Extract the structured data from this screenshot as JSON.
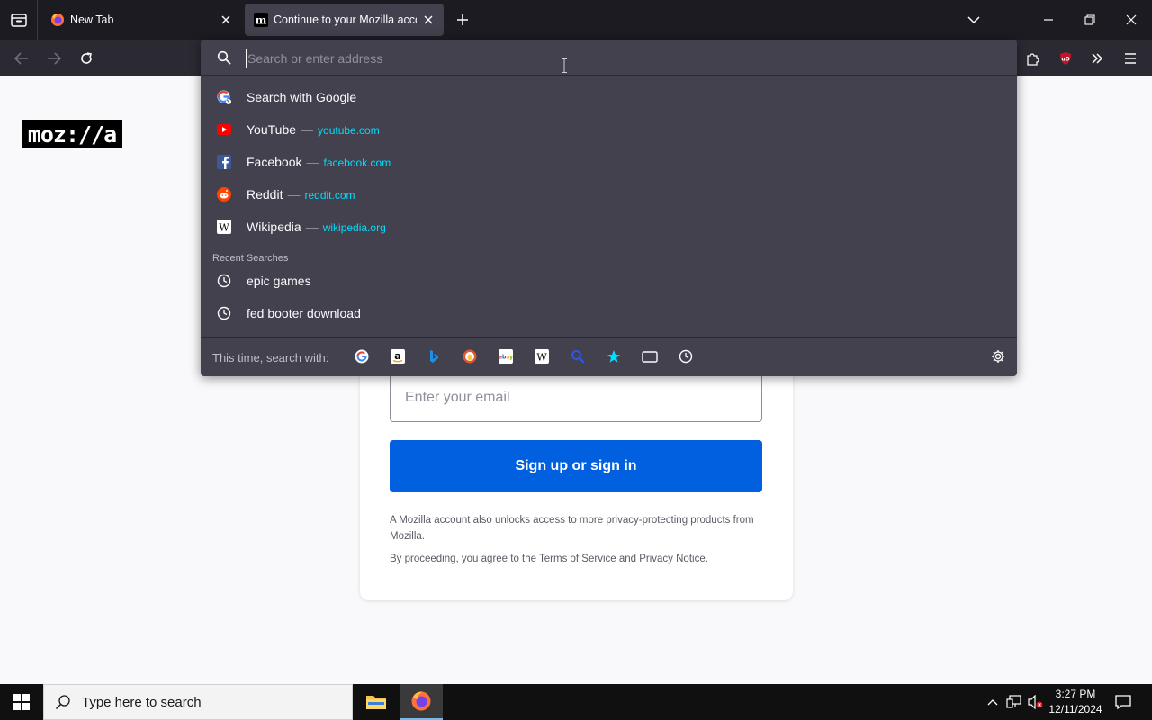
{
  "browser": {
    "tabs": [
      {
        "title": "New Tab",
        "favicon": "firefox-icon",
        "active": false
      },
      {
        "title": "Continue to your Mozilla account",
        "favicon": "mozilla-m-icon",
        "active": true
      }
    ]
  },
  "urlbar": {
    "placeholder": "Search or enter address",
    "value": "",
    "suggestions": [
      {
        "label": "Search with Google",
        "url": "",
        "icon": "google-icon"
      },
      {
        "label": "YouTube",
        "url": "youtube.com",
        "icon": "youtube-icon"
      },
      {
        "label": "Facebook",
        "url": "facebook.com",
        "icon": "facebook-icon"
      },
      {
        "label": "Reddit",
        "url": "reddit.com",
        "icon": "reddit-icon"
      },
      {
        "label": "Wikipedia",
        "url": "wikipedia.org",
        "icon": "wikipedia-icon"
      }
    ],
    "separator": "—",
    "recent_label": "Recent Searches",
    "recent": [
      "epic games",
      "fed booter download"
    ],
    "oneoff_label": "This time, search with:",
    "engines": [
      "google",
      "amazon",
      "bing",
      "duckduckgo",
      "ebay",
      "wikipedia",
      "search",
      "bookmarks",
      "tabs",
      "history"
    ]
  },
  "page": {
    "logo": "moz://a",
    "email_placeholder": "Enter your email",
    "signin_label": "Sign up or sign in",
    "legal_text": "A Mozilla account also unlocks access to more privacy-protecting products from Mozilla.",
    "terms_prefix": "By proceeding, you agree to the ",
    "terms_link": "Terms of Service",
    "terms_and": " and ",
    "privacy_link": "Privacy Notice",
    "terms_suffix": "."
  },
  "taskbar": {
    "search_placeholder": "Type here to search",
    "time": "3:27 PM",
    "date": "12/11/2024"
  },
  "colors": {
    "accent": "#0060df",
    "url_link": "#00ddff",
    "popup_bg": "#42414d",
    "toolbar_bg": "#2b2a33"
  }
}
